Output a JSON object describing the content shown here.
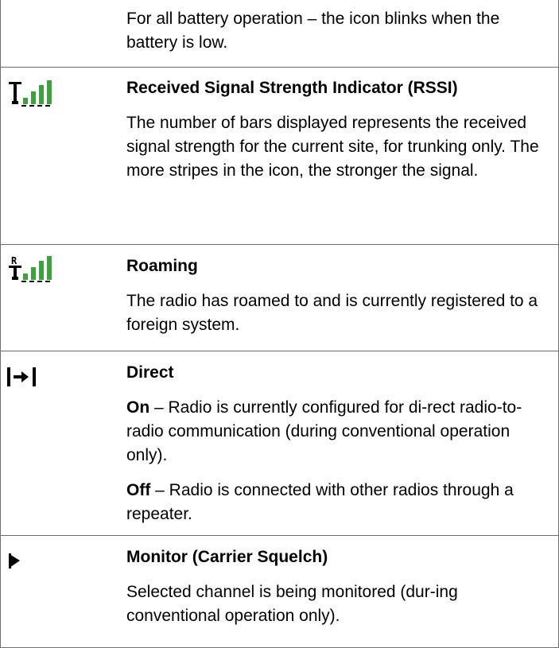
{
  "rows": [
    {
      "id": "battery",
      "title": "",
      "paragraphs": [
        "For all battery operation – the icon blinks when the battery is low."
      ]
    },
    {
      "id": "rssi",
      "icon": "signal-strength-icon",
      "title": "Received Signal Strength Indicator (RSSI)",
      "paragraphs": [
        "The number of bars displayed represents the received signal strength for the current site, for trunking only. The more stripes in the icon, the stronger the signal."
      ]
    },
    {
      "id": "roaming",
      "icon": "roaming-icon",
      "title": "Roaming",
      "paragraphs": [
        "The radio has roamed to and is currently registered to a foreign system."
      ]
    },
    {
      "id": "direct",
      "icon": "direct-icon",
      "title": "Direct",
      "on_label": "On",
      "on_text": " – Radio is currently configured for di-rect radio-to-radio communication (during conventional operation only).",
      "off_label": "Off",
      "off_text": " – Radio is connected with other radios through a repeater."
    },
    {
      "id": "monitor",
      "icon": "monitor-icon",
      "title": "Monitor (Carrier Squelch)",
      "paragraphs": [
        "Selected channel is being monitored (dur-ing conventional operation only)."
      ]
    }
  ],
  "colors": {
    "signal_green": "#3aa33a",
    "border": "#6e6e6e"
  }
}
